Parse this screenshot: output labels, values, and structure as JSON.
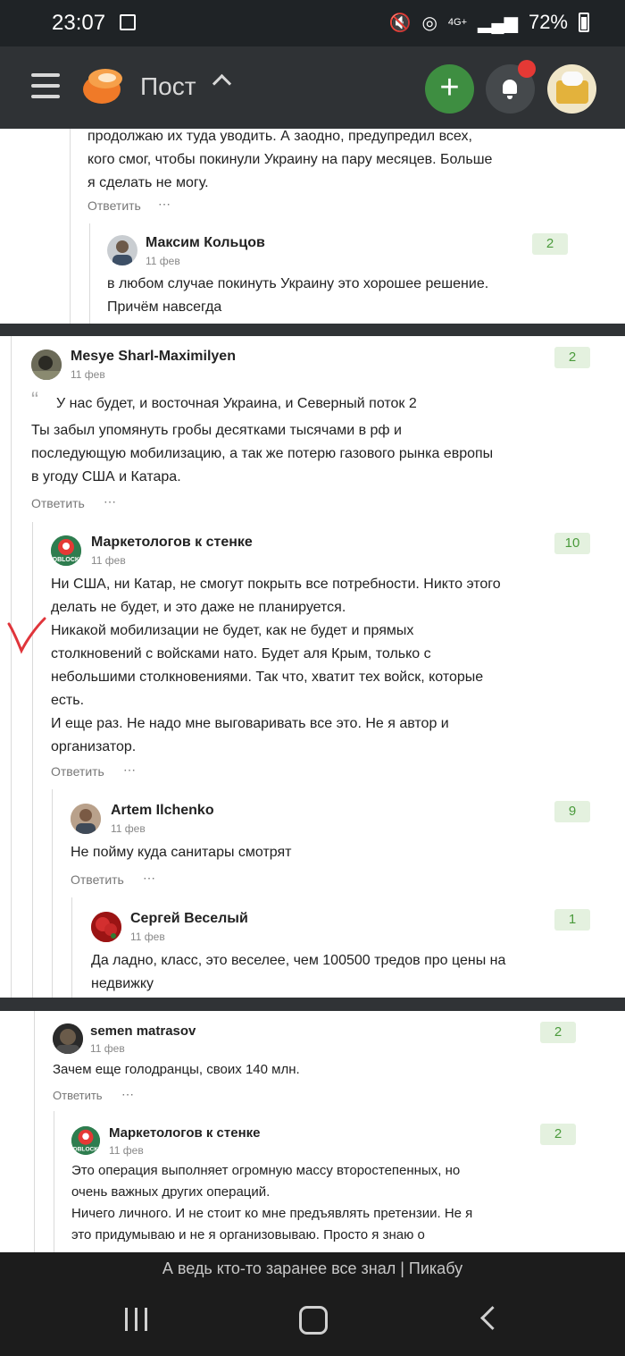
{
  "status_bar": {
    "time": "23:07",
    "network": "4G+",
    "battery": "72%"
  },
  "header": {
    "title": "Пост",
    "add_label": "+"
  },
  "comments": {
    "c0": {
      "lines": [
        "продолжаю их туда уводить. А заодно, предупредил всех,",
        "кого смог, чтобы покинули Украину на пару месяцев. Больше",
        "я сделать не могу."
      ],
      "reply": "Ответить",
      "more": "⋯"
    },
    "c1": {
      "author": "Максим Кольцов",
      "date": "11 фев",
      "score": "2",
      "lines": [
        "в любом случае покинуть Украину это хорошее решение.",
        "Причём навсегда"
      ]
    },
    "c2": {
      "author": "Mesye Sharl-Maximilyen",
      "date": "11 фев",
      "score": "2",
      "quote": "У нас будет, и восточная Украина, и Северный поток 2",
      "lines": [
        "Ты забыл упомянуть гробы десятками тысячами в рф и",
        "последующую мобилизацию, а так же потерю газового рынка европы",
        "в угоду США и Катара."
      ],
      "reply": "Ответить",
      "more": "⋯"
    },
    "c3": {
      "author": "Маркетологов к стенке",
      "date": "11 фев",
      "score": "10",
      "lines": [
        "Ни США, ни Катар, не смогут покрыть все потребности. Никто этого",
        "делать не будет, и это даже не планируется.",
        "Никакой мобилизации не будет, как не будет и прямых",
        "столкновений с войсками нато. Будет аля Крым, только с",
        "небольшими столкновениями. Так что, хватит тех войск, которые",
        "есть.",
        "И еще раз. Не надо мне выговаривать все это. Не я автор и",
        "организатор."
      ],
      "reply": "Ответить",
      "more": "⋯"
    },
    "c4": {
      "author": "Artem Ilchenko",
      "date": "11 фев",
      "score": "9",
      "lines": [
        "Не пойму куда санитары смотрят"
      ],
      "reply": "Ответить",
      "more": "⋯"
    },
    "c5": {
      "author": "Сергей Веселый",
      "date": "11 фев",
      "score": "1",
      "lines": [
        "Да ладно, класс, это веселее, чем 100500 тредов про цены на",
        "недвижку"
      ]
    },
    "c6": {
      "author": "semen matrasov",
      "date": "11 фев",
      "score": "2",
      "lines": [
        "Зачем еще голодранцы, своих 140 млн."
      ],
      "reply": "Ответить",
      "more": "⋯"
    },
    "c7": {
      "author": "Маркетологов к стенке",
      "date": "11 фев",
      "score": "2",
      "lines": [
        "Это операция выполняет огромную массу второстепенных, но",
        "очень важных других операций.",
        "Ничего личного. И не стоит ко мне предъявлять претензии. Не я",
        "это придумываю и не я организовываю. Просто я знаю о"
      ]
    }
  },
  "caption": "А ведь кто-то заранее все знал | Пикабу",
  "colors": {
    "topbar": "#2f3235",
    "add_button": "#3e8e41",
    "notification_dot": "#e53935",
    "score_bg": "#e4f1df",
    "score_text": "#4a9a3b",
    "annotation_mark": "#e0353b"
  }
}
